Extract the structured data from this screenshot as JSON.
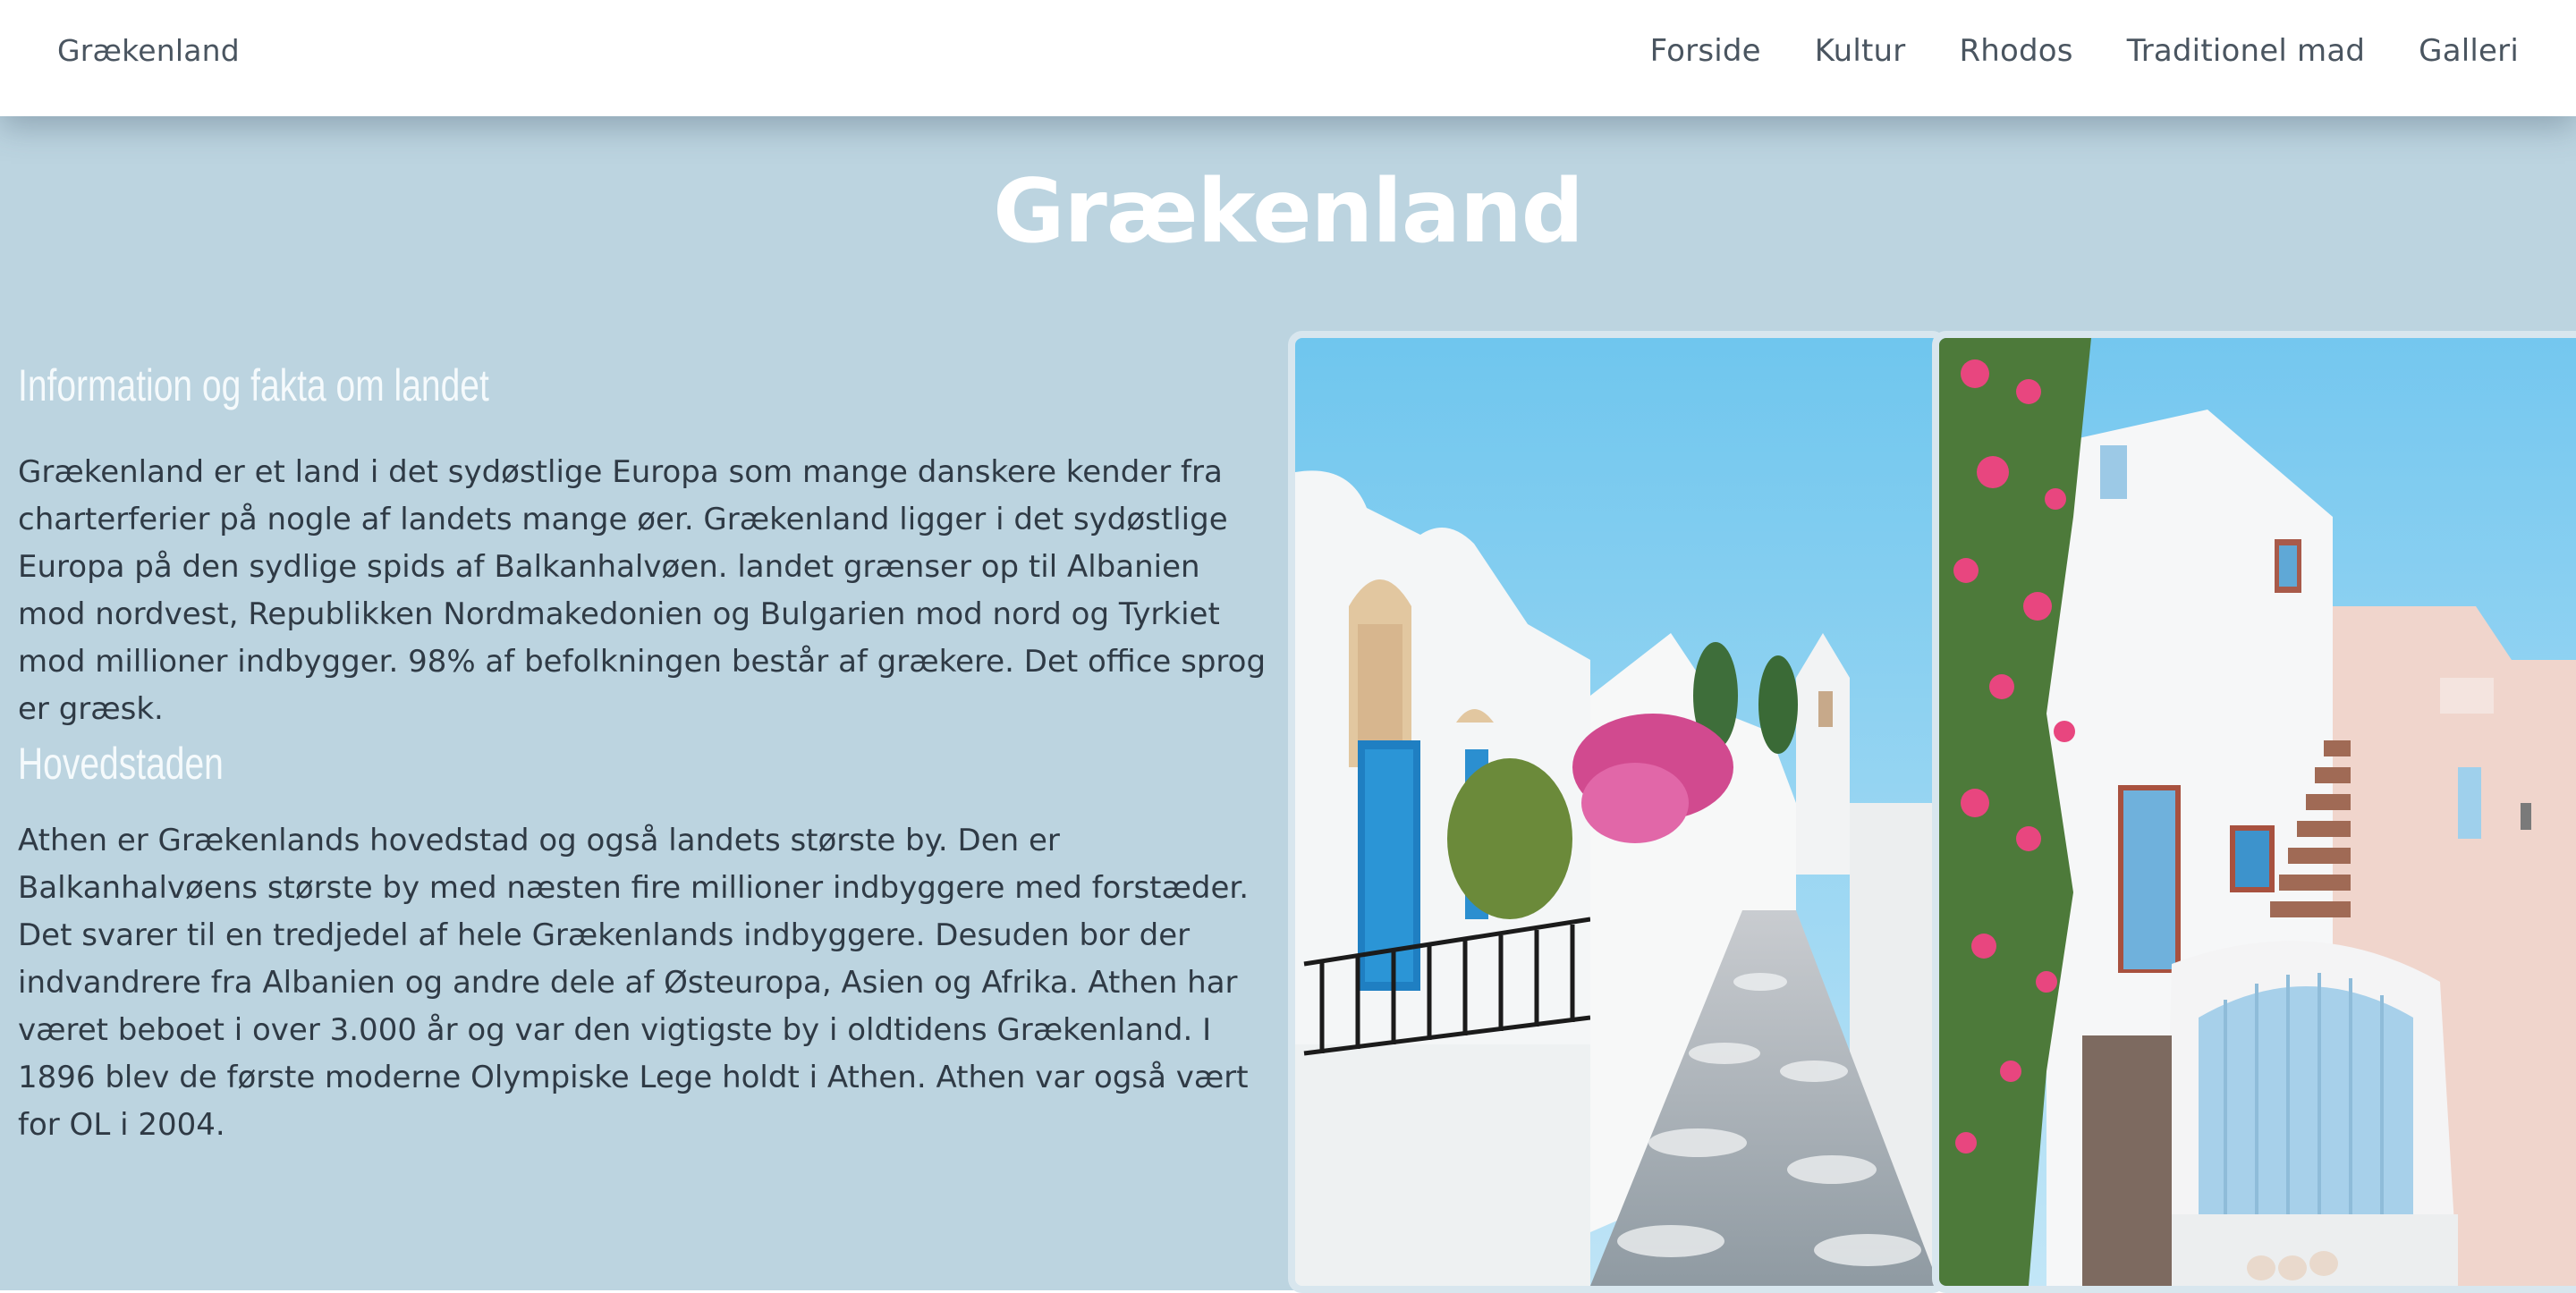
{
  "nav": {
    "brand": "Grækenland",
    "links": [
      "Forside",
      "Kultur",
      "Rhodos",
      "Traditionel mad",
      "Galleri"
    ]
  },
  "page": {
    "title": "Grækenland"
  },
  "sections": [
    {
      "heading": "Information og fakta om landet",
      "body": "Grækenland er et land i det sydøstlige Europa som mange danskere kender fra charterferier på nogle af landets mange øer. Grækenland ligger i det sydøstlige Europa på den sydlige spids af Balkanhalvøen. landet grænser op til Albanien mod nordvest, Republikken Nordmakedonien og Bulgarien mod nord og Tyrkiet mod millioner indbygger. 98% af befolkningen består af grækere. Det office sprog er græsk."
    },
    {
      "heading": "Hovedstaden",
      "body": "Athen er Grækenlands hovedstad og også landets største by. Den er Balkanhalvøens største by med næsten fire millioner indbyggere med forstæder. Det svarer til en tredjedel af hele Grækenlands indbyggere. Desuden bor der indvandrere fra Albanien og andre dele af Østeuropa, Asien og Afrika. Athen har været beboet i over 3.000 år og var den vigtigste by i oldtidens Grækenland. I 1896 blev de første moderne Olympiske Lege holdt i Athen. Athen var også vært for OL i 2004."
    }
  ],
  "colors": {
    "hero_background": "#bcd4e0",
    "nav_text": "#4a5560",
    "body_text": "#2f3a45",
    "heading_text": "#f5fafc"
  }
}
